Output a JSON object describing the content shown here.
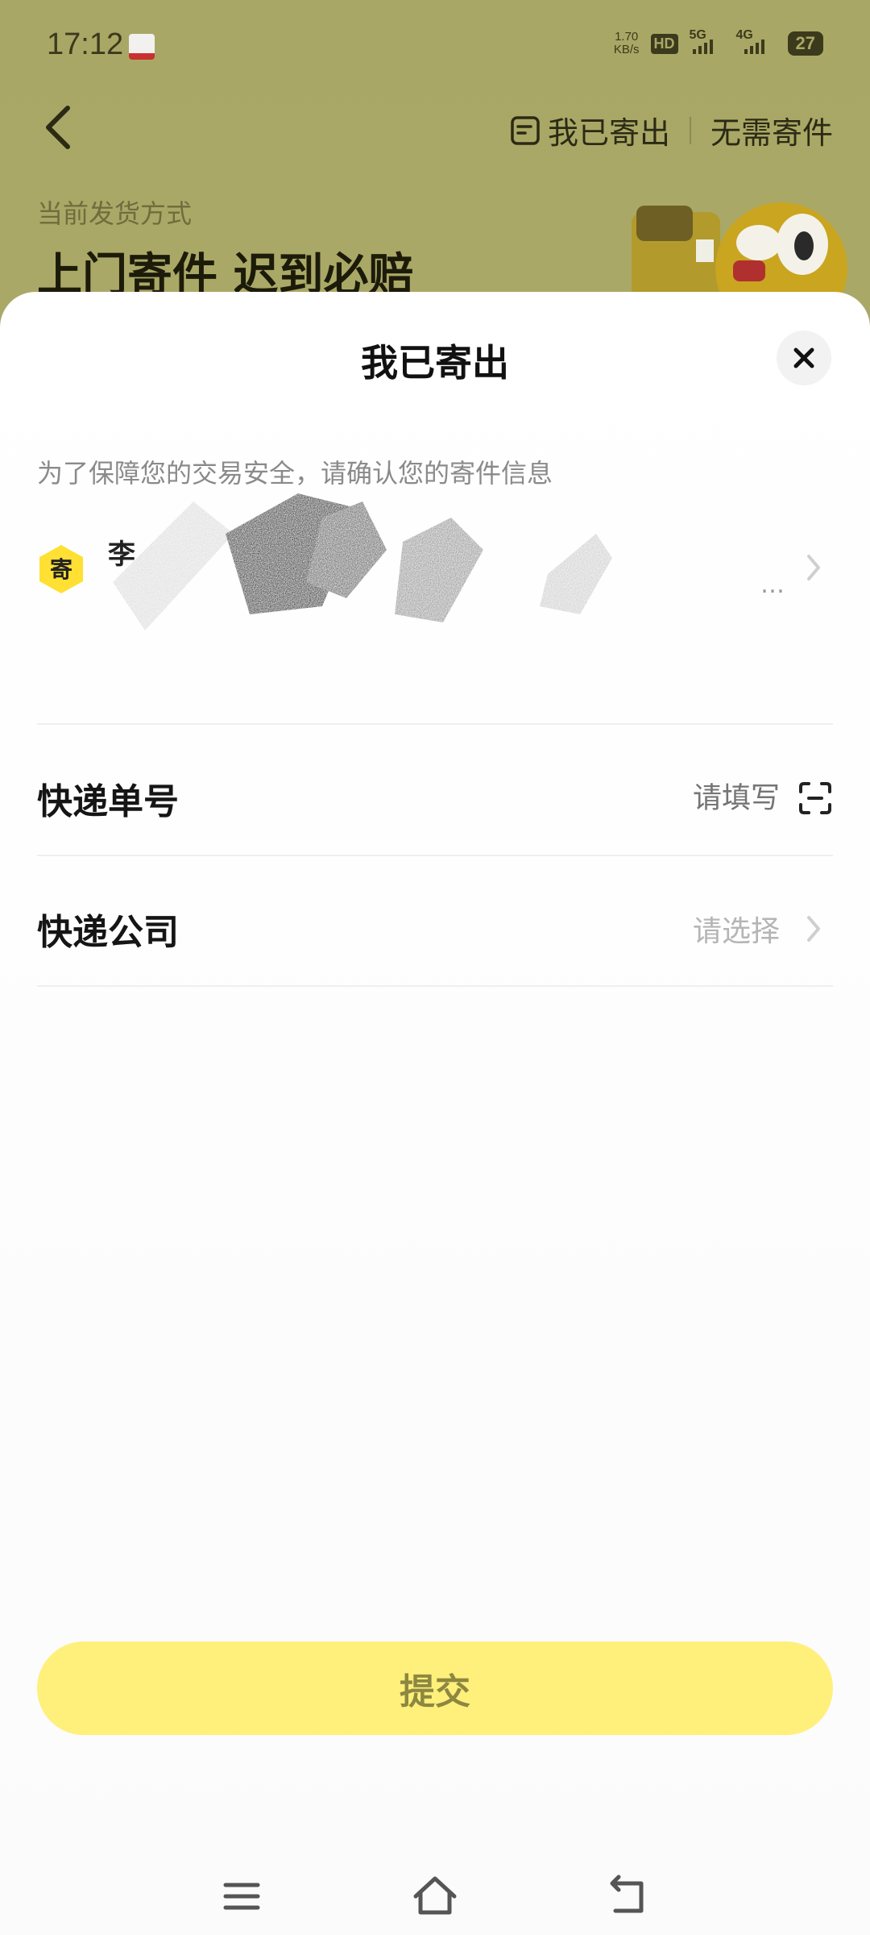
{
  "status_bar": {
    "time": "17:12",
    "net_speed_value": "1.70",
    "net_speed_unit": "KB/s",
    "hd_label": "HD",
    "sim1_label": "5G",
    "sim2_label": "4G",
    "battery": "27"
  },
  "background": {
    "nav": {
      "sent_label": "我已寄出",
      "no_ship_label": "无需寄件"
    },
    "delivery_method_label": "当前发货方式",
    "delivery_method_title": "上门寄件 迟到必赔"
  },
  "sheet": {
    "title": "我已寄出",
    "hint": "为了保障您的交易安全，请确认您的寄件信息",
    "sender": {
      "badge": "寄",
      "name": "李",
      "ellipsis": "…"
    },
    "tracking": {
      "label": "快递单号",
      "placeholder": "请填写"
    },
    "company": {
      "label": "快递公司",
      "placeholder": "请选择"
    },
    "submit_label": "提交"
  },
  "icons": {
    "back": "chevron-left-icon",
    "sent": "notebook-icon",
    "close": "close-icon",
    "scan": "scan-icon",
    "chevron": "chevron-right-icon",
    "menu": "menu-icon",
    "home": "home-icon",
    "back_nav": "return-icon"
  },
  "colors": {
    "accent_yellow": "#fef07a",
    "badge_yellow": "#ffe033",
    "dim_overlay": "#a9a765"
  }
}
